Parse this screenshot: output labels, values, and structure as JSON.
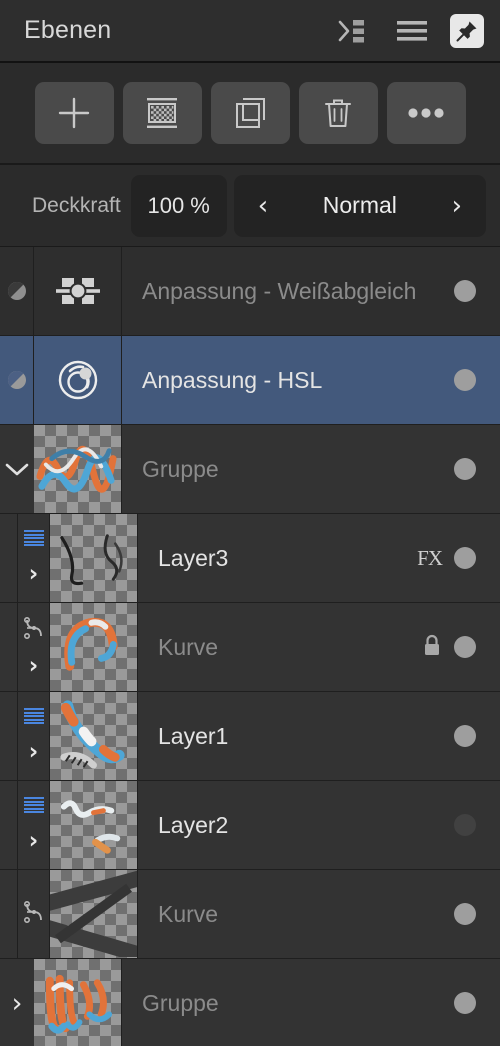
{
  "header": {
    "title": "Ebenen",
    "icons": [
      {
        "name": "collapse-all-icon"
      },
      {
        "name": "menu-icon"
      },
      {
        "name": "pin-icon",
        "active": true
      }
    ]
  },
  "toolbar": {
    "buttons": [
      {
        "name": "add-layer-button",
        "icon": "plus-icon"
      },
      {
        "name": "add-mask-button",
        "icon": "mask-checkerboard-icon"
      },
      {
        "name": "duplicate-layer-button",
        "icon": "duplicate-icon"
      },
      {
        "name": "delete-layer-button",
        "icon": "trash-icon"
      },
      {
        "name": "more-options-button",
        "icon": "ellipsis-icon"
      }
    ]
  },
  "opacity": {
    "label": "Deckkraft",
    "value": "100 %"
  },
  "blend": {
    "mode": "Normal",
    "prev_glyph": "‹",
    "next_glyph": "›"
  },
  "badges": {
    "fx": "FX",
    "lock": "lock-icon"
  },
  "layers": [
    {
      "name": "Anpassung - Weißabgleich",
      "type": "adjustment",
      "icon": "white-balance-icon",
      "indent": 0,
      "selected": false,
      "dimmed": true,
      "visible": true,
      "expander": "none",
      "badges": []
    },
    {
      "name": "Anpassung - HSL",
      "type": "adjustment",
      "icon": "hsl-icon",
      "indent": 0,
      "selected": true,
      "dimmed": false,
      "visible": true,
      "expander": "none",
      "badges": []
    },
    {
      "name": "Gruppe",
      "type": "group",
      "icon": "thumbnail",
      "indent": 0,
      "selected": false,
      "dimmed": true,
      "visible": true,
      "expander": "expanded",
      "badges": []
    },
    {
      "name": "Layer3",
      "type": "pixel",
      "icon": "pixel-layer-icon",
      "indent": 1,
      "selected": false,
      "dimmed": false,
      "visible": true,
      "expander": "collapsed",
      "badges": [
        "FX"
      ]
    },
    {
      "name": "Kurve",
      "type": "curve",
      "icon": "curve-layer-icon",
      "indent": 1,
      "selected": false,
      "dimmed": true,
      "visible": true,
      "expander": "collapsed",
      "badges": [
        "lock"
      ]
    },
    {
      "name": "Layer1",
      "type": "pixel",
      "icon": "pixel-layer-icon",
      "indent": 1,
      "selected": false,
      "dimmed": false,
      "visible": true,
      "expander": "collapsed",
      "badges": []
    },
    {
      "name": "Layer2",
      "type": "pixel",
      "icon": "pixel-layer-icon",
      "indent": 1,
      "selected": false,
      "dimmed": false,
      "visible": false,
      "expander": "collapsed",
      "badges": []
    },
    {
      "name": "Kurve",
      "type": "curve",
      "icon": "curve-layer-icon",
      "indent": 1,
      "selected": false,
      "dimmed": true,
      "visible": true,
      "expander": "none",
      "badges": []
    },
    {
      "name": "Gruppe",
      "type": "group",
      "icon": "thumbnail",
      "indent": 0,
      "selected": false,
      "dimmed": true,
      "visible": true,
      "expander": "collapsed",
      "badges": []
    }
  ],
  "colors": {
    "panel_background": "#2b2b2b",
    "header_background": "#2e2e2e",
    "row_background": "#333333",
    "adjustment_row_background": "#2e2e2e",
    "selection_blue": "#43597c",
    "text_primary": "#e4e4e4",
    "text_dim": "#8b8b8b",
    "visibility_dot_on": "#9e9e9e",
    "visibility_dot_off": "#414141",
    "pixel_layer_accent": "#4a86e0",
    "tool_button_background": "#4a4a4a",
    "field_background": "#232323"
  }
}
